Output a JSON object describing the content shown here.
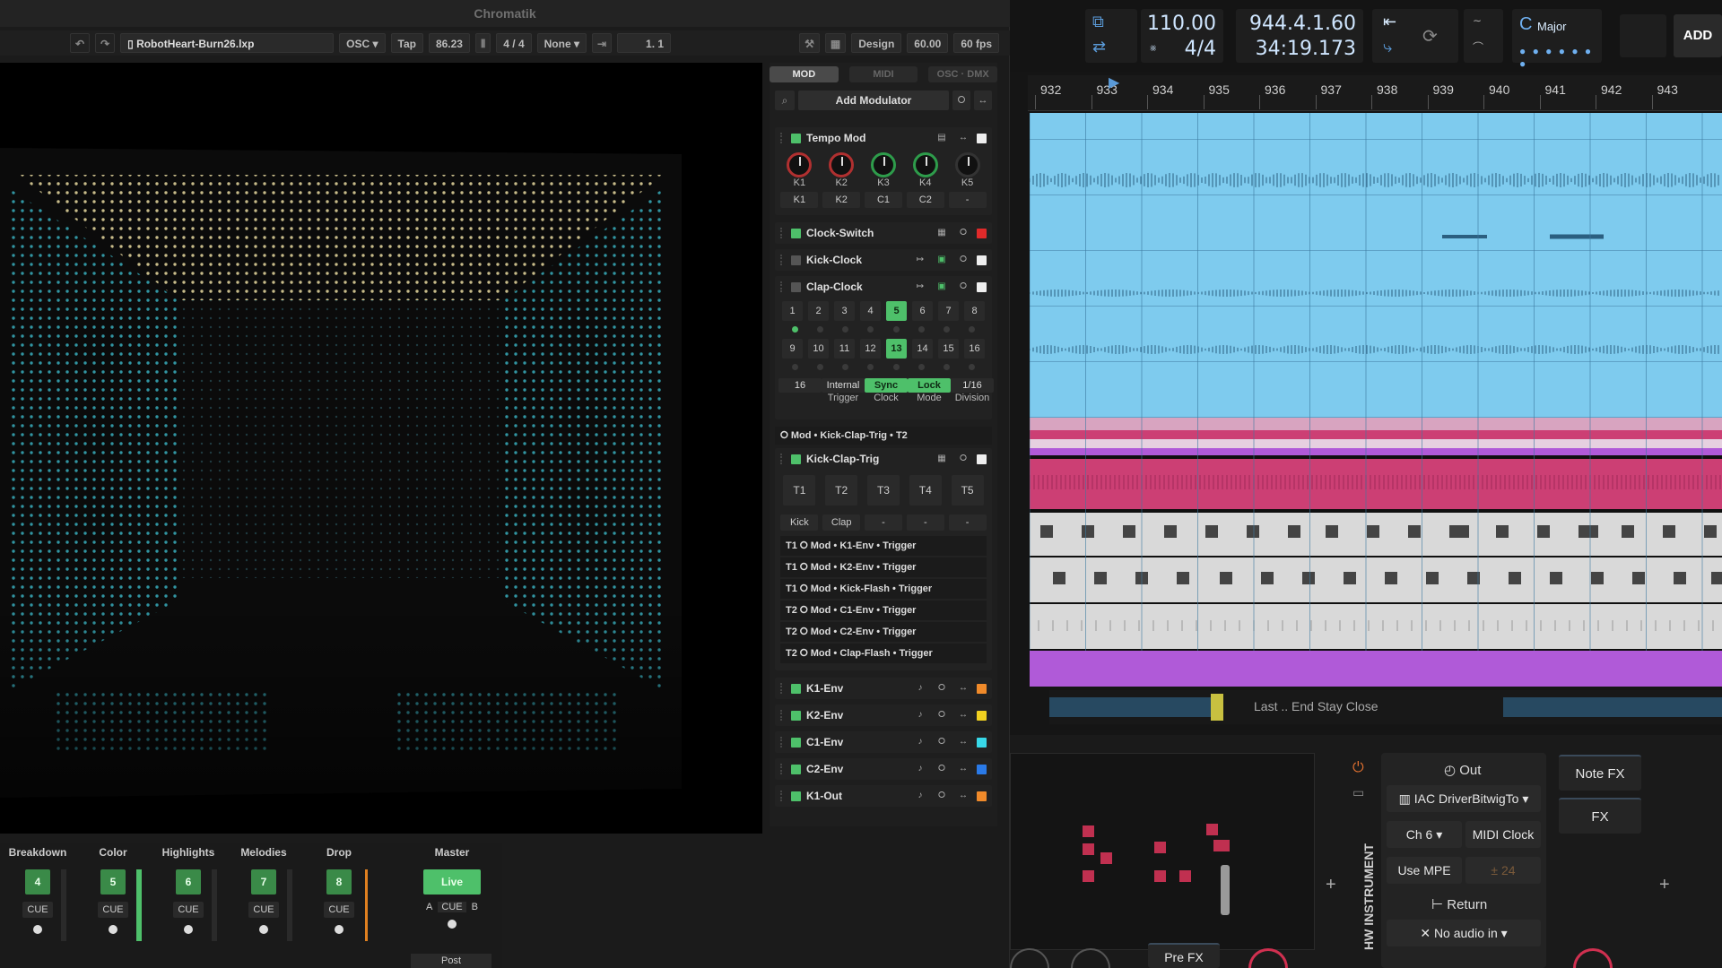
{
  "chromatik": {
    "title": "Chromatik",
    "toolbar": {
      "filename": "RobotHeart-Burn26.lxp",
      "osc": "OSC",
      "tap": "Tap",
      "bpm": "86.23",
      "timesig": "4 / 4",
      "quant": "None",
      "position": "1. 1",
      "design": "Design",
      "fps_val": "60.00",
      "fps": "60 fps"
    },
    "tabs": [
      "MOD",
      "MIDI",
      "OSC · DMX"
    ],
    "add_modulator": "Add Modulator",
    "tempo_mod": {
      "title": "Tempo Mod",
      "knobs": [
        "K1",
        "K2",
        "K3",
        "K4",
        "K5"
      ],
      "chips": [
        "K1",
        "K2",
        "C1",
        "C2",
        "-"
      ]
    },
    "clock_switch": "Clock-Switch",
    "kick_clock": "Kick-Clock",
    "clap_clock": {
      "title": "Clap-Clock",
      "steps": [
        "1",
        "2",
        "3",
        "4",
        "5",
        "6",
        "7",
        "8",
        "9",
        "10",
        "11",
        "12",
        "13",
        "14",
        "15",
        "16"
      ],
      "active_steps": [
        5,
        13
      ],
      "controls": [
        {
          "value": "16",
          "label": ""
        },
        {
          "value": "Internal",
          "label": "Trigger"
        },
        {
          "value": "Sync",
          "label": "Clock"
        },
        {
          "value": "Lock",
          "label": "Mode"
        },
        {
          "value": "1/16",
          "label": "Division"
        }
      ],
      "routing": "Mod • Kick-Clap-Trig • T2"
    },
    "kick_clap_trig": {
      "title": "Kick-Clap-Trig",
      "triggers": [
        "T1",
        "T2",
        "T3",
        "T4",
        "T5"
      ],
      "trigger_labels": [
        "Kick",
        "Clap",
        "-",
        "-",
        "-"
      ],
      "routes": [
        "T1 ⭘ Mod • K1-Env • Trigger",
        "T1 ⭘ Mod • K2-Env • Trigger",
        "T1 ⭘ Mod • Kick-Flash • Trigger",
        "T2 ⭘ Mod • C1-Env • Trigger",
        "T2 ⭘ Mod • C2-Env • Trigger",
        "T2 ⭘ Mod • Clap-Flash • Trigger"
      ]
    },
    "envelopes": [
      {
        "name": "K1-Env",
        "color": "#f08a2a"
      },
      {
        "name": "K2-Env",
        "color": "#f0d020"
      },
      {
        "name": "C1-Env",
        "color": "#38d8e8"
      },
      {
        "name": "C2-Env",
        "color": "#2a7ae8"
      },
      {
        "name": "K1-Out",
        "color": "#f08a2a"
      }
    ],
    "scenes": [
      {
        "name": "Breakdown",
        "num": "4",
        "cue": "CUE"
      },
      {
        "name": "Color",
        "num": "5",
        "cue": "CUE"
      },
      {
        "name": "Highlights",
        "num": "6",
        "cue": "CUE"
      },
      {
        "name": "Melodies",
        "num": "7",
        "cue": "CUE"
      },
      {
        "name": "Drop",
        "num": "8",
        "cue": "CUE"
      }
    ],
    "master": {
      "name": "Master",
      "live": "Live",
      "a": "A",
      "cue": "CUE",
      "b": "B",
      "post": "Post"
    }
  },
  "bitwig": {
    "tempo": "110.00",
    "timesig": "4/4",
    "position_bars": "944.4.1.60",
    "position_time": "34:19.173",
    "key": "C",
    "scale": "Major",
    "add": "ADD",
    "bars": [
      "932",
      "933",
      "934",
      "935",
      "936",
      "937",
      "938",
      "939",
      "940",
      "941",
      "942",
      "943"
    ],
    "marker_text": "Last .. End Stay Close",
    "device": {
      "title": "HW INSTRUMENT",
      "out": "Out",
      "midi_out": "IAC DriverBitwigTo",
      "channel": "Ch 6",
      "midi_clock": "MIDI Clock",
      "mpe": "Use MPE",
      "pb": "± 24",
      "return": "Return",
      "audio_in": "No audio in",
      "note_fx": "Note FX",
      "fx": "FX",
      "pre_fx": "Pre FX"
    }
  },
  "colors": {
    "accent_green": "#4ec06a",
    "clip_blue": "#7ecbee",
    "clip_pink": "#cc3f74",
    "clip_purple": "#b05ad8"
  }
}
